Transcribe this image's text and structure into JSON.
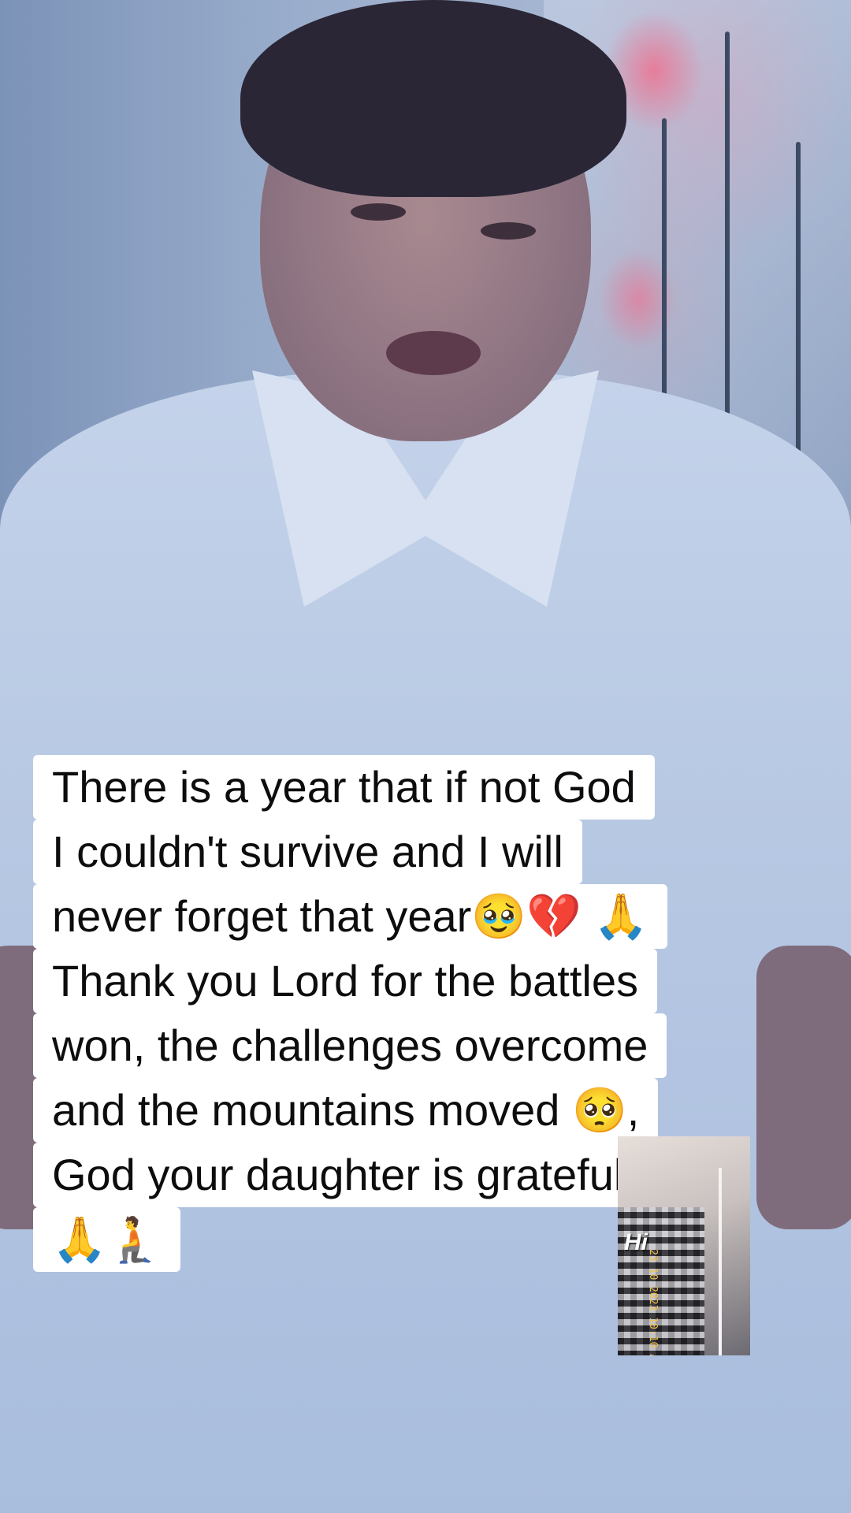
{
  "caption": {
    "lines": [
      "There is a year that if not  God",
      "I couldn't survive and I will",
      "never forget that year🥹💔 🙏",
      "Thank you Lord for the battles",
      "won, the challenges overcome",
      "and the mountains moved 🥺,",
      "God your daughter is grateful",
      "🙏🧎"
    ]
  },
  "inset_photo": {
    "logo_text": "Hi",
    "timestamp_text": "23 10 2023 10:10 AM"
  }
}
